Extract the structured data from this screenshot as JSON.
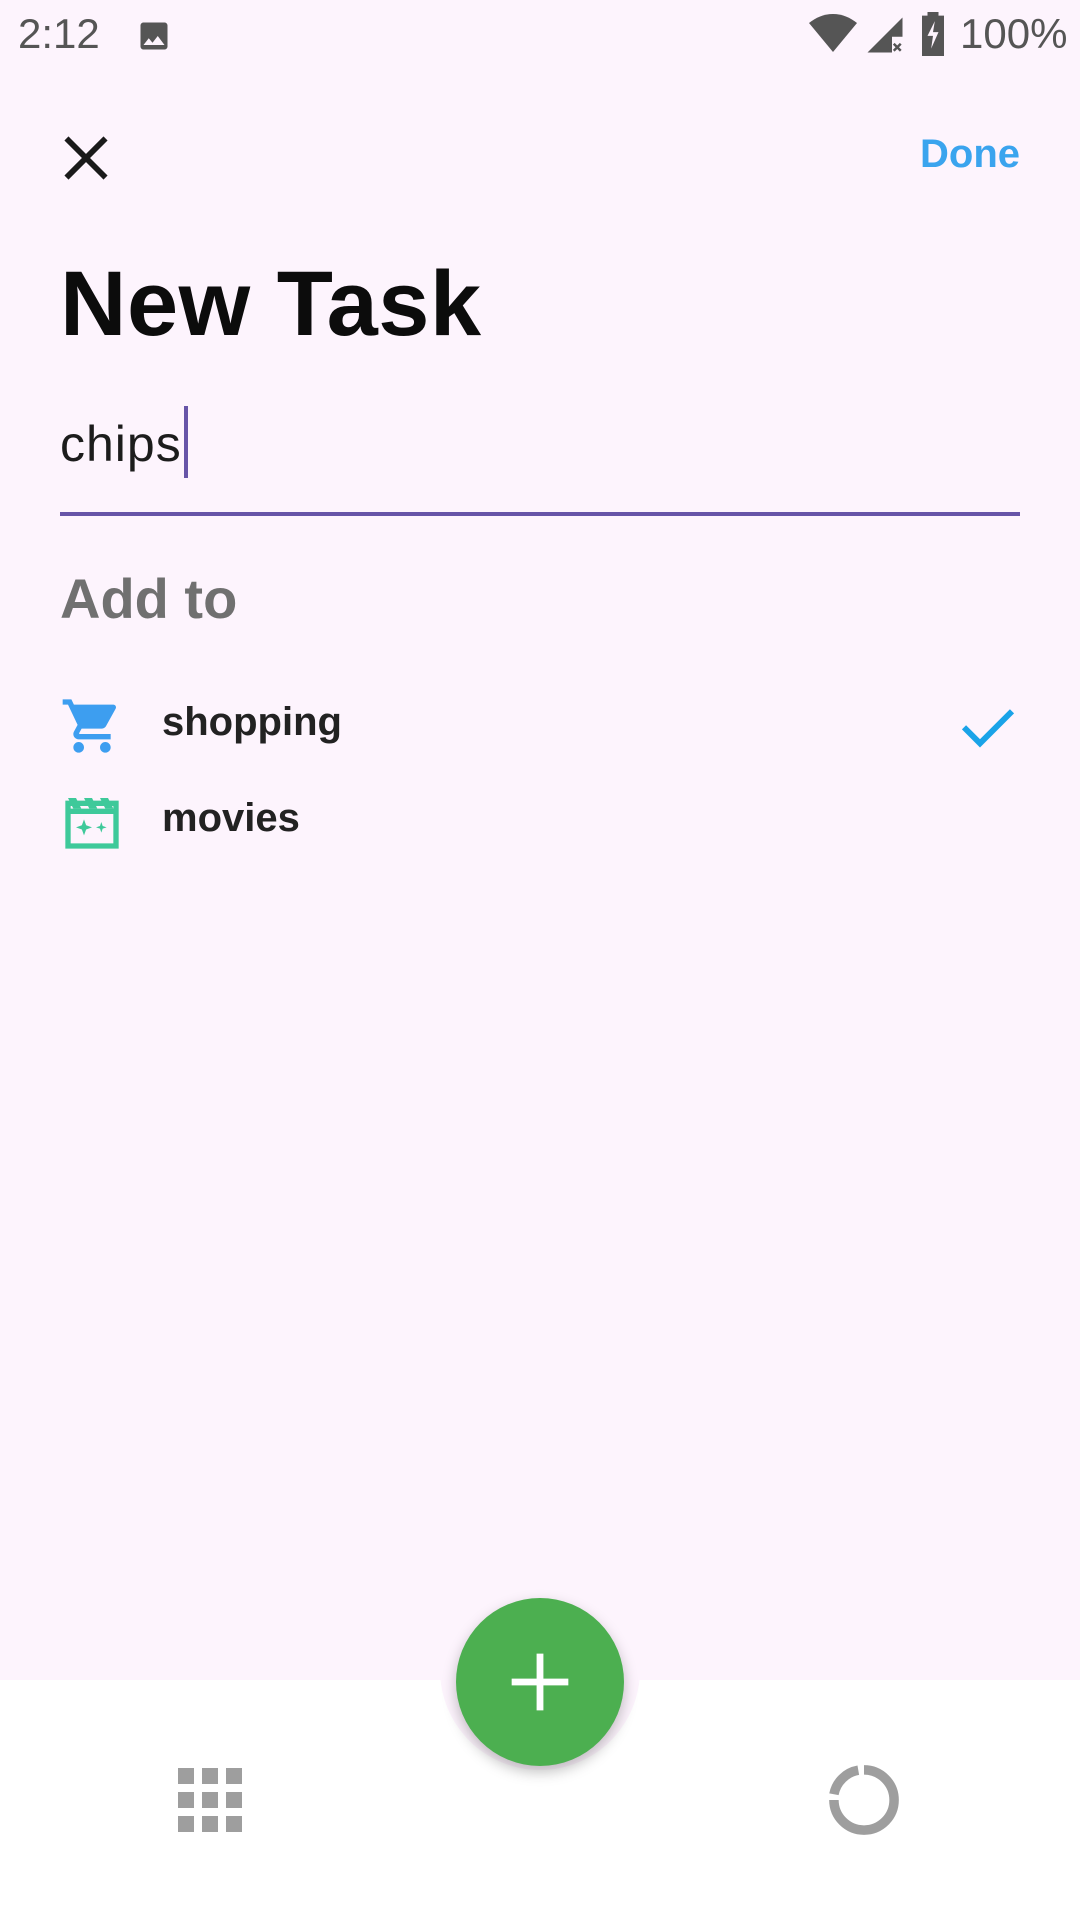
{
  "status_bar": {
    "time": "2:12",
    "battery": "100%",
    "icons": [
      "gallery-icon",
      "wifi-icon",
      "signal-icon",
      "battery-icon"
    ]
  },
  "header": {
    "close_icon": "close-icon",
    "done_label": "Done"
  },
  "title": "New Task",
  "task_input": {
    "value": "chips"
  },
  "add_to": {
    "heading": "Add to",
    "lists": [
      {
        "label": "shopping",
        "icon": "shopping-cart-icon",
        "color": "#3d9ef0",
        "selected": true
      },
      {
        "label": "movies",
        "icon": "movie-clapper-icon",
        "color": "#3ec99a",
        "selected": false
      }
    ]
  },
  "bottom_nav": {
    "left_icon": "grid-icon",
    "fab_icon": "plus-icon",
    "right_icon": "progress-ring-icon"
  },
  "colors": {
    "accent": "#3aa4ee",
    "input_underline": "#6754a8",
    "fab": "#4caf50",
    "background": "#fdf4fd"
  }
}
